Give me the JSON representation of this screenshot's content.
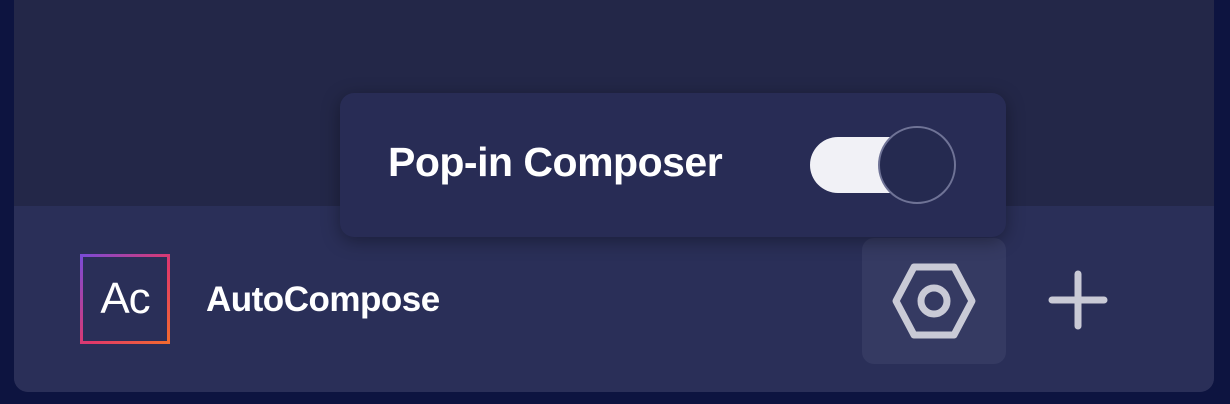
{
  "popover": {
    "label": "Pop-in Composer",
    "toggle_on": true
  },
  "footer": {
    "logo_text": "Ac",
    "app_name": "AutoCompose",
    "settings_icon": "hex-gear-icon",
    "add_icon": "plus-icon"
  },
  "colors": {
    "background": "#0d1440",
    "panel": "#252a50",
    "footer": "#2a2f58",
    "popover": "#282c55",
    "toggle_track": "#f1f1f6",
    "logo_gradient": [
      "#7a4bd6",
      "#e0386a",
      "#f26a2e"
    ],
    "icon": "#c9cad6"
  }
}
